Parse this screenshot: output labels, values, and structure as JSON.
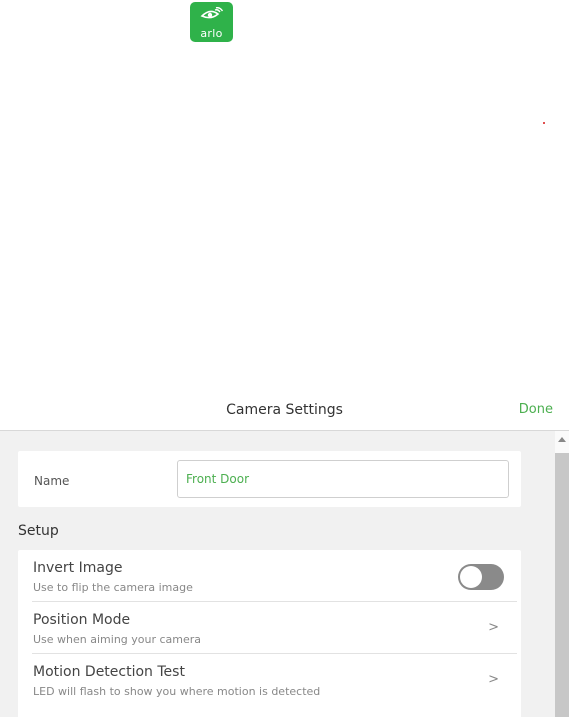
{
  "logo": {
    "text": "arlo",
    "icon": "arlo-eye-icon"
  },
  "header": {
    "title": "Camera Settings",
    "done_label": "Done"
  },
  "name_card": {
    "label": "Name",
    "value": "Front Door"
  },
  "setup": {
    "title": "Setup",
    "items": [
      {
        "title": "Invert Image",
        "subtitle": "Use to flip the camera image",
        "control": "toggle",
        "toggle_on": false
      },
      {
        "title": "Position Mode",
        "subtitle": "Use when aiming your camera",
        "control": "chevron",
        "chevron": ">"
      },
      {
        "title": "Motion Detection Test",
        "subtitle": "LED will flash to show you where motion is detected",
        "control": "chevron",
        "chevron": ">"
      }
    ]
  },
  "colors": {
    "accent_green": "#4caf50",
    "logo_green": "#2fb24a",
    "toggle_off": "#8a8a8a"
  }
}
